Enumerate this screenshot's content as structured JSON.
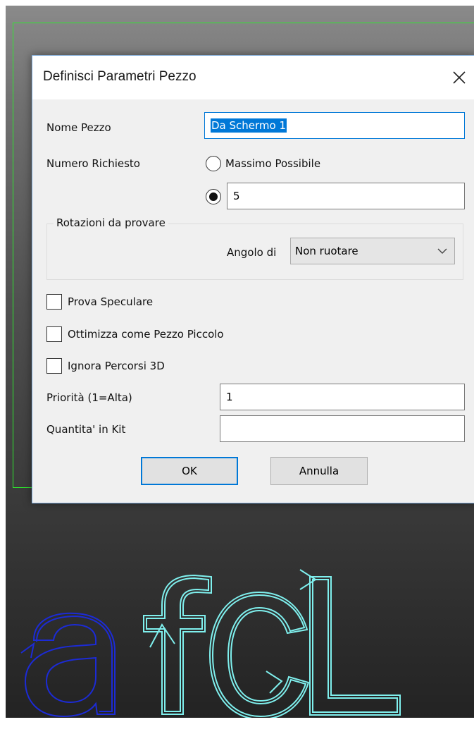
{
  "dialog": {
    "title": "Definisci Parametri Pezzo",
    "name_label": "Nome Pezzo",
    "name_value": "Da Schermo 1",
    "quantity_label": "Numero Richiesto",
    "option_max_label": "Massimo Possibile",
    "option_max_selected": false,
    "option_count_selected": true,
    "count_value": "5",
    "rotations_group_label": "Rotazioni da provare",
    "angle_label": "Angolo di",
    "angle_value": "Non ruotare",
    "mirror_label": "Prova Speculare",
    "mirror_checked": false,
    "small_part_label": "Ottimizza come Pezzo Piccolo",
    "small_part_checked": false,
    "ignore_3d_label": "Ignora Percorsi 3D",
    "ignore_3d_checked": false,
    "priority_label": "Priorità (1=Alta)",
    "priority_value": "1",
    "kit_label": "Quantita' in Kit",
    "kit_value": "",
    "ok_label": "OK",
    "cancel_label": "Annulla"
  },
  "colors": {
    "selection_rect": "#2ee82e",
    "letter_a": "#1c2bd6",
    "letters_fcl": "#7ff0ee",
    "focus_blue": "#0078d7",
    "selected_text_bg": "#0078d7"
  },
  "icons": {
    "close": "close-icon",
    "combo_arrow": "chevron-down-icon"
  }
}
